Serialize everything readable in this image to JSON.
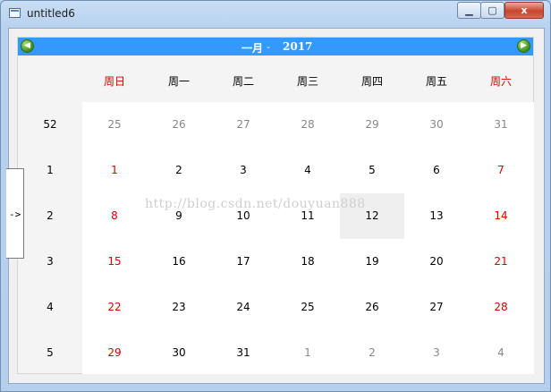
{
  "window": {
    "title": "untitled6",
    "min_label": "▁",
    "max_label": "▢",
    "close_label": "x"
  },
  "calendar": {
    "nav": {
      "prev_icon": "green-left-arrow-icon",
      "next_icon": "green-right-arrow-icon",
      "prev_glyph": "◀",
      "next_glyph": "▶"
    },
    "month": "一月",
    "month_dropdown_glyph": "⌄",
    "year": "2017",
    "days_of_week": [
      {
        "label": "周日",
        "weekend": true
      },
      {
        "label": "周一",
        "weekend": false
      },
      {
        "label": "周二",
        "weekend": false
      },
      {
        "label": "周三",
        "weekend": false
      },
      {
        "label": "周四",
        "weekend": false
      },
      {
        "label": "周五",
        "weekend": false
      },
      {
        "label": "周六",
        "weekend": true
      }
    ],
    "weeks": [
      {
        "week": "52",
        "days": [
          "25",
          "26",
          "27",
          "28",
          "29",
          "30",
          "31"
        ],
        "other_month": [
          true,
          true,
          true,
          true,
          true,
          true,
          true
        ]
      },
      {
        "week": "1",
        "days": [
          "1",
          "2",
          "3",
          "4",
          "5",
          "6",
          "7"
        ],
        "other_month": [
          false,
          false,
          false,
          false,
          false,
          false,
          false
        ]
      },
      {
        "week": "2",
        "days": [
          "8",
          "9",
          "10",
          "11",
          "12",
          "13",
          "14"
        ],
        "other_month": [
          false,
          false,
          false,
          false,
          false,
          false,
          false
        ]
      },
      {
        "week": "3",
        "days": [
          "15",
          "16",
          "17",
          "18",
          "19",
          "20",
          "21"
        ],
        "other_month": [
          false,
          false,
          false,
          false,
          false,
          false,
          false
        ]
      },
      {
        "week": "4",
        "days": [
          "22",
          "23",
          "24",
          "25",
          "26",
          "27",
          "28"
        ],
        "other_month": [
          false,
          false,
          false,
          false,
          false,
          false,
          false
        ]
      },
      {
        "week": "5",
        "days": [
          "29",
          "30",
          "31",
          "1",
          "2",
          "3",
          "4"
        ],
        "other_month": [
          false,
          false,
          false,
          true,
          true,
          true,
          true
        ]
      }
    ],
    "selected": {
      "week_index": 2,
      "day_index": 4
    },
    "colors": {
      "header": "#3399ff",
      "weekend": "#d40000",
      "other_month": "#888888"
    }
  },
  "side_tab": {
    "label": "->"
  },
  "watermark": "http://blog.csdn.net/douyuan888"
}
